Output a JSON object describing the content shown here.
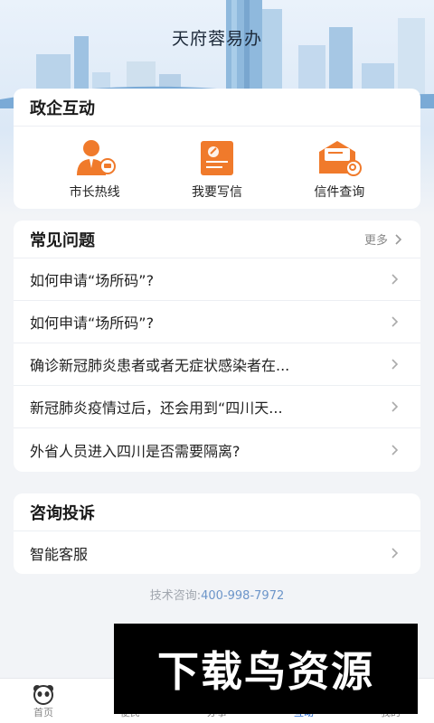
{
  "header": {
    "title": "天府蓉易办"
  },
  "gov_interaction": {
    "title": "政企互动",
    "items": [
      {
        "label": "市长热线",
        "icon": "mayor-hotline-icon"
      },
      {
        "label": "我要写信",
        "icon": "write-letter-icon"
      },
      {
        "label": "信件查询",
        "icon": "letter-query-icon"
      }
    ]
  },
  "faq": {
    "title": "常见问题",
    "more_label": "更多",
    "items": [
      "如何申请“场所码”?",
      "如何申请“场所码”?",
      "确诊新冠肺炎患者或者无症状感染者在...",
      "新冠肺炎疫情过后，还会用到“四川天...",
      "外省人员进入四川是否需要隔离?"
    ]
  },
  "consult": {
    "title": "咨询投诉",
    "items": [
      "智能客服"
    ]
  },
  "footer": {
    "tech_label": "技术咨询:",
    "tech_phone": "400-998-7972"
  },
  "tabbar": {
    "tabs": [
      {
        "label": "首页",
        "active": false
      },
      {
        "label": "便民",
        "active": false
      },
      {
        "label": "办事",
        "active": false
      },
      {
        "label": "互动",
        "active": true
      },
      {
        "label": "我的",
        "active": false
      }
    ]
  },
  "watermark": {
    "text": "下载鸟资源"
  },
  "colors": {
    "accent_orange": "#f07a2b",
    "accent_blue": "#2b6fd6",
    "phone_blue": "#6c95c9"
  }
}
